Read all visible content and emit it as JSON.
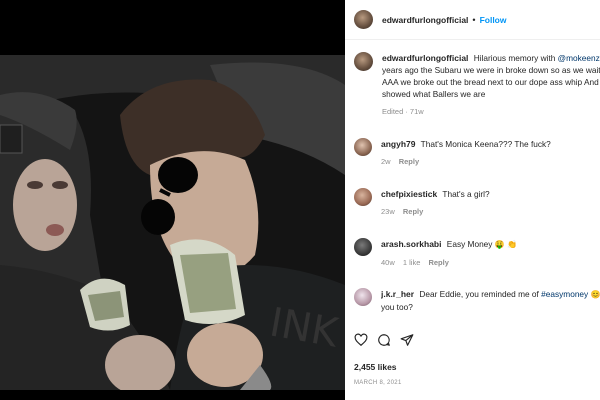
{
  "post": {
    "author": "edwardfurlongofficial",
    "separator": "•",
    "follow_label": "Follow"
  },
  "caption": {
    "author": "edwardfurlongofficial",
    "line1": "Hilarious memory with",
    "mention": "@mokeenz",
    "line1_tail": "c",
    "line2": "years ago the Subaru we were in broke down so as we wait",
    "line3": "AAA we broke out the bread next to our dope ass whip And",
    "line4": "showed what Ballers we are",
    "meta": "Edited · 71w"
  },
  "comments": [
    {
      "user": "angyh79",
      "text": "That's Monica Keena??? The fuck?",
      "time": "2w",
      "likes": "",
      "reply": "Reply"
    },
    {
      "user": "chefpixiestick",
      "text": "That's a girl?",
      "time": "23w",
      "likes": "",
      "reply": "Reply"
    },
    {
      "user": "arash.sorkhabi",
      "text": "Easy Money",
      "emoji": "🤑 👏",
      "time": "40w",
      "likes": "1 like",
      "reply": "Reply"
    },
    {
      "user": "j.k.r_her",
      "text": "Dear Eddie, you reminded me of",
      "hashtag": "#easymoney",
      "emoji": "😊",
      "text2": "you too?",
      "time": "",
      "likes": "",
      "reply": ""
    }
  ],
  "footer": {
    "likes": "2,455 likes",
    "date": "MARCH 8, 2021"
  },
  "icons": {
    "like": "heart-icon",
    "comment": "comment-icon",
    "share": "paper-plane-icon"
  },
  "colors": {
    "accent": "#0095f6",
    "mention": "#00376b",
    "muted": "#8e8e8e"
  }
}
